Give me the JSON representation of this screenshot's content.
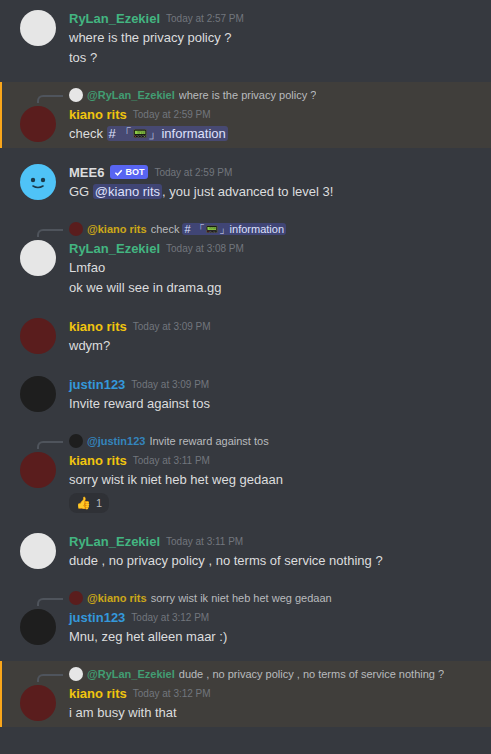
{
  "messages": [
    {
      "author": {
        "name": "RyLan_Ezekiel",
        "color": "#43b581",
        "avatar": "#e6e6e6",
        "bot": false,
        "badge": ""
      },
      "time": "Today at 2:57 PM",
      "highlighted": false,
      "reply": null,
      "lines": [
        [
          {
            "kind": "text",
            "text": "where is the privacy policy ?"
          }
        ],
        [
          {
            "kind": "text",
            "text": "tos ?"
          }
        ]
      ],
      "reactions": []
    },
    {
      "author": {
        "name": "kiano rits",
        "color": "#f1c40f",
        "avatar": "#5a1d1d",
        "bot": false,
        "badge": ""
      },
      "time": "Today at 2:59 PM",
      "highlighted": true,
      "reply": {
        "author": "@RyLan_Ezekiel",
        "color": "#43b581",
        "avatar": "#e6e6e6",
        "segments": [
          {
            "kind": "text",
            "text": "where is the privacy policy ?"
          }
        ]
      },
      "lines": [
        [
          {
            "kind": "text",
            "text": "check "
          },
          {
            "kind": "mention",
            "text": "# 「📟」information"
          }
        ]
      ],
      "reactions": []
    },
    {
      "author": {
        "name": "MEE6",
        "color": "#dcddde",
        "avatar": "#4fc3f7",
        "bot": true,
        "badge": "BOT"
      },
      "time": "Today at 2:59 PM",
      "highlighted": false,
      "reply": null,
      "lines": [
        [
          {
            "kind": "text",
            "text": "GG "
          },
          {
            "kind": "mention",
            "text": "@kiano rits"
          },
          {
            "kind": "text",
            "text": ", you just advanced to level 3!"
          }
        ]
      ],
      "reactions": []
    },
    {
      "author": {
        "name": "RyLan_Ezekiel",
        "color": "#43b581",
        "avatar": "#e6e6e6",
        "bot": false,
        "badge": ""
      },
      "time": "Today at 3:08 PM",
      "highlighted": false,
      "reply": {
        "author": "@kiano rits",
        "color": "#f1c40f",
        "avatar": "#5a1d1d",
        "segments": [
          {
            "kind": "text",
            "text": "check "
          },
          {
            "kind": "mention",
            "text": "# 「📟」information"
          }
        ]
      },
      "lines": [
        [
          {
            "kind": "text",
            "text": "Lmfao"
          }
        ],
        [
          {
            "kind": "text",
            "text": "ok we will see in drama.gg"
          }
        ]
      ],
      "reactions": []
    },
    {
      "author": {
        "name": "kiano rits",
        "color": "#f1c40f",
        "avatar": "#5a1d1d",
        "bot": false,
        "badge": ""
      },
      "time": "Today at 3:09 PM",
      "highlighted": false,
      "reply": null,
      "lines": [
        [
          {
            "kind": "text",
            "text": "wdym?"
          }
        ]
      ],
      "reactions": []
    },
    {
      "author": {
        "name": "justin123",
        "color": "#3498db",
        "avatar": "#1e1e1e",
        "bot": false,
        "badge": ""
      },
      "time": "Today at 3:09 PM",
      "highlighted": false,
      "reply": null,
      "lines": [
        [
          {
            "kind": "text",
            "text": "Invite reward against tos"
          }
        ]
      ],
      "reactions": []
    },
    {
      "author": {
        "name": "kiano rits",
        "color": "#f1c40f",
        "avatar": "#5a1d1d",
        "bot": false,
        "badge": ""
      },
      "time": "Today at 3:11 PM",
      "highlighted": false,
      "reply": {
        "author": "@justin123",
        "color": "#3498db",
        "avatar": "#1e1e1e",
        "segments": [
          {
            "kind": "text",
            "text": "Invite reward against tos"
          }
        ]
      },
      "lines": [
        [
          {
            "kind": "text",
            "text": "sorry wist ik niet heb het weg gedaan"
          }
        ]
      ],
      "reactions": [
        {
          "emoji": "👍",
          "count": "1"
        }
      ]
    },
    {
      "author": {
        "name": "RyLan_Ezekiel",
        "color": "#43b581",
        "avatar": "#e6e6e6",
        "bot": false,
        "badge": ""
      },
      "time": "Today at 3:11 PM",
      "highlighted": false,
      "reply": null,
      "lines": [
        [
          {
            "kind": "text",
            "text": "dude , no privacy policy , no terms of service nothing ?"
          }
        ]
      ],
      "reactions": []
    },
    {
      "author": {
        "name": "justin123",
        "color": "#3498db",
        "avatar": "#1e1e1e",
        "bot": false,
        "badge": ""
      },
      "time": "Today at 3:12 PM",
      "highlighted": false,
      "reply": {
        "author": "@kiano rits",
        "color": "#f1c40f",
        "avatar": "#5a1d1d",
        "segments": [
          {
            "kind": "text",
            "text": "sorry wist ik niet heb het weg gedaan"
          }
        ]
      },
      "lines": [
        [
          {
            "kind": "text",
            "text": "Mnu, zeg het alleen maar :)"
          }
        ]
      ],
      "reactions": []
    },
    {
      "author": {
        "name": "kiano rits",
        "color": "#f1c40f",
        "avatar": "#5a1d1d",
        "bot": false,
        "badge": ""
      },
      "time": "Today at 3:12 PM",
      "highlighted": true,
      "reply": {
        "author": "@RyLan_Ezekiel",
        "color": "#43b581",
        "avatar": "#e6e6e6",
        "segments": [
          {
            "kind": "text",
            "text": "dude , no privacy policy , no terms of service nothing ?"
          }
        ]
      },
      "lines": [
        [
          {
            "kind": "text",
            "text": "i am busy with that"
          }
        ]
      ],
      "reactions": []
    }
  ]
}
